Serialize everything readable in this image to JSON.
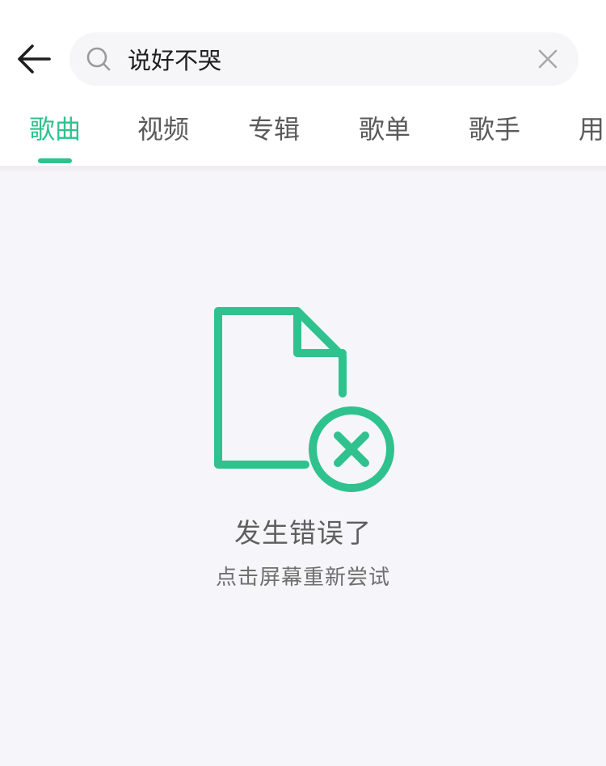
{
  "header": {
    "back_icon": "arrow-left-icon",
    "search": {
      "icon": "search-icon",
      "value": "说好不哭",
      "clear_icon": "close-icon"
    }
  },
  "tabs": {
    "active_index": 0,
    "items": [
      {
        "label": "歌曲"
      },
      {
        "label": "视频"
      },
      {
        "label": "专辑"
      },
      {
        "label": "歌单"
      },
      {
        "label": "歌手"
      },
      {
        "label": "用"
      }
    ]
  },
  "error": {
    "icon": "file-error-icon",
    "title": "发生错误了",
    "subtitle": "点击屏幕重新尝试"
  },
  "colors": {
    "accent": "#2fc28e",
    "text_primary": "#1e1e1e",
    "text_secondary": "#5a5a5a",
    "background": "#f6f5f9"
  }
}
